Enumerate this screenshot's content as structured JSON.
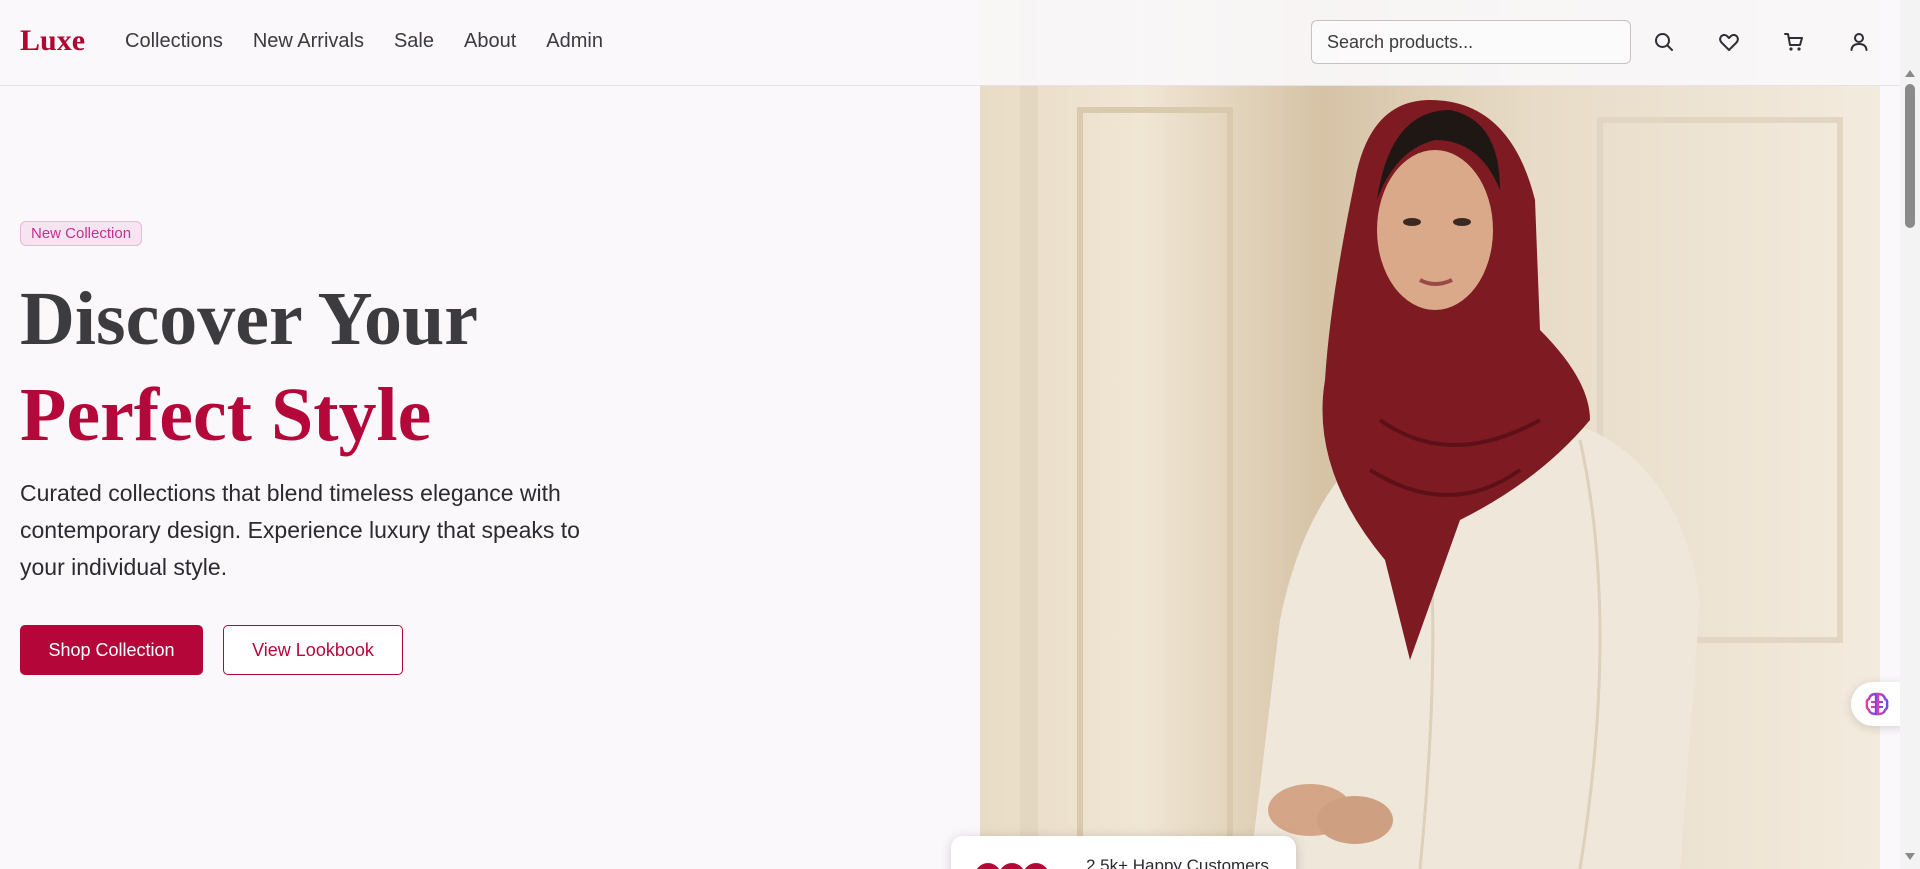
{
  "header": {
    "logo": "Luxe",
    "nav": [
      "Collections",
      "New Arrivals",
      "Sale",
      "About",
      "Admin"
    ],
    "search_placeholder": "Search products...",
    "icons": [
      "search-icon",
      "heart-icon",
      "cart-icon",
      "user-icon"
    ]
  },
  "hero": {
    "badge": "New Collection",
    "title_line1": "Discover Your",
    "title_line2": "Perfect Style",
    "subtitle": "Curated collections that blend timeless elegance with contemporary design. Experience luxury that speaks to your individual style.",
    "primary_button": "Shop Collection",
    "secondary_button": "View Lookbook",
    "customers_text": "2.5k+ Happy Customers"
  },
  "colors": {
    "brand": "#b5063a",
    "badge_text": "#c2318f",
    "heading_dark": "#3c3b3f",
    "background": "#fbf8fb"
  },
  "floating": {
    "ai_assistant_icon": "brain-icon"
  }
}
